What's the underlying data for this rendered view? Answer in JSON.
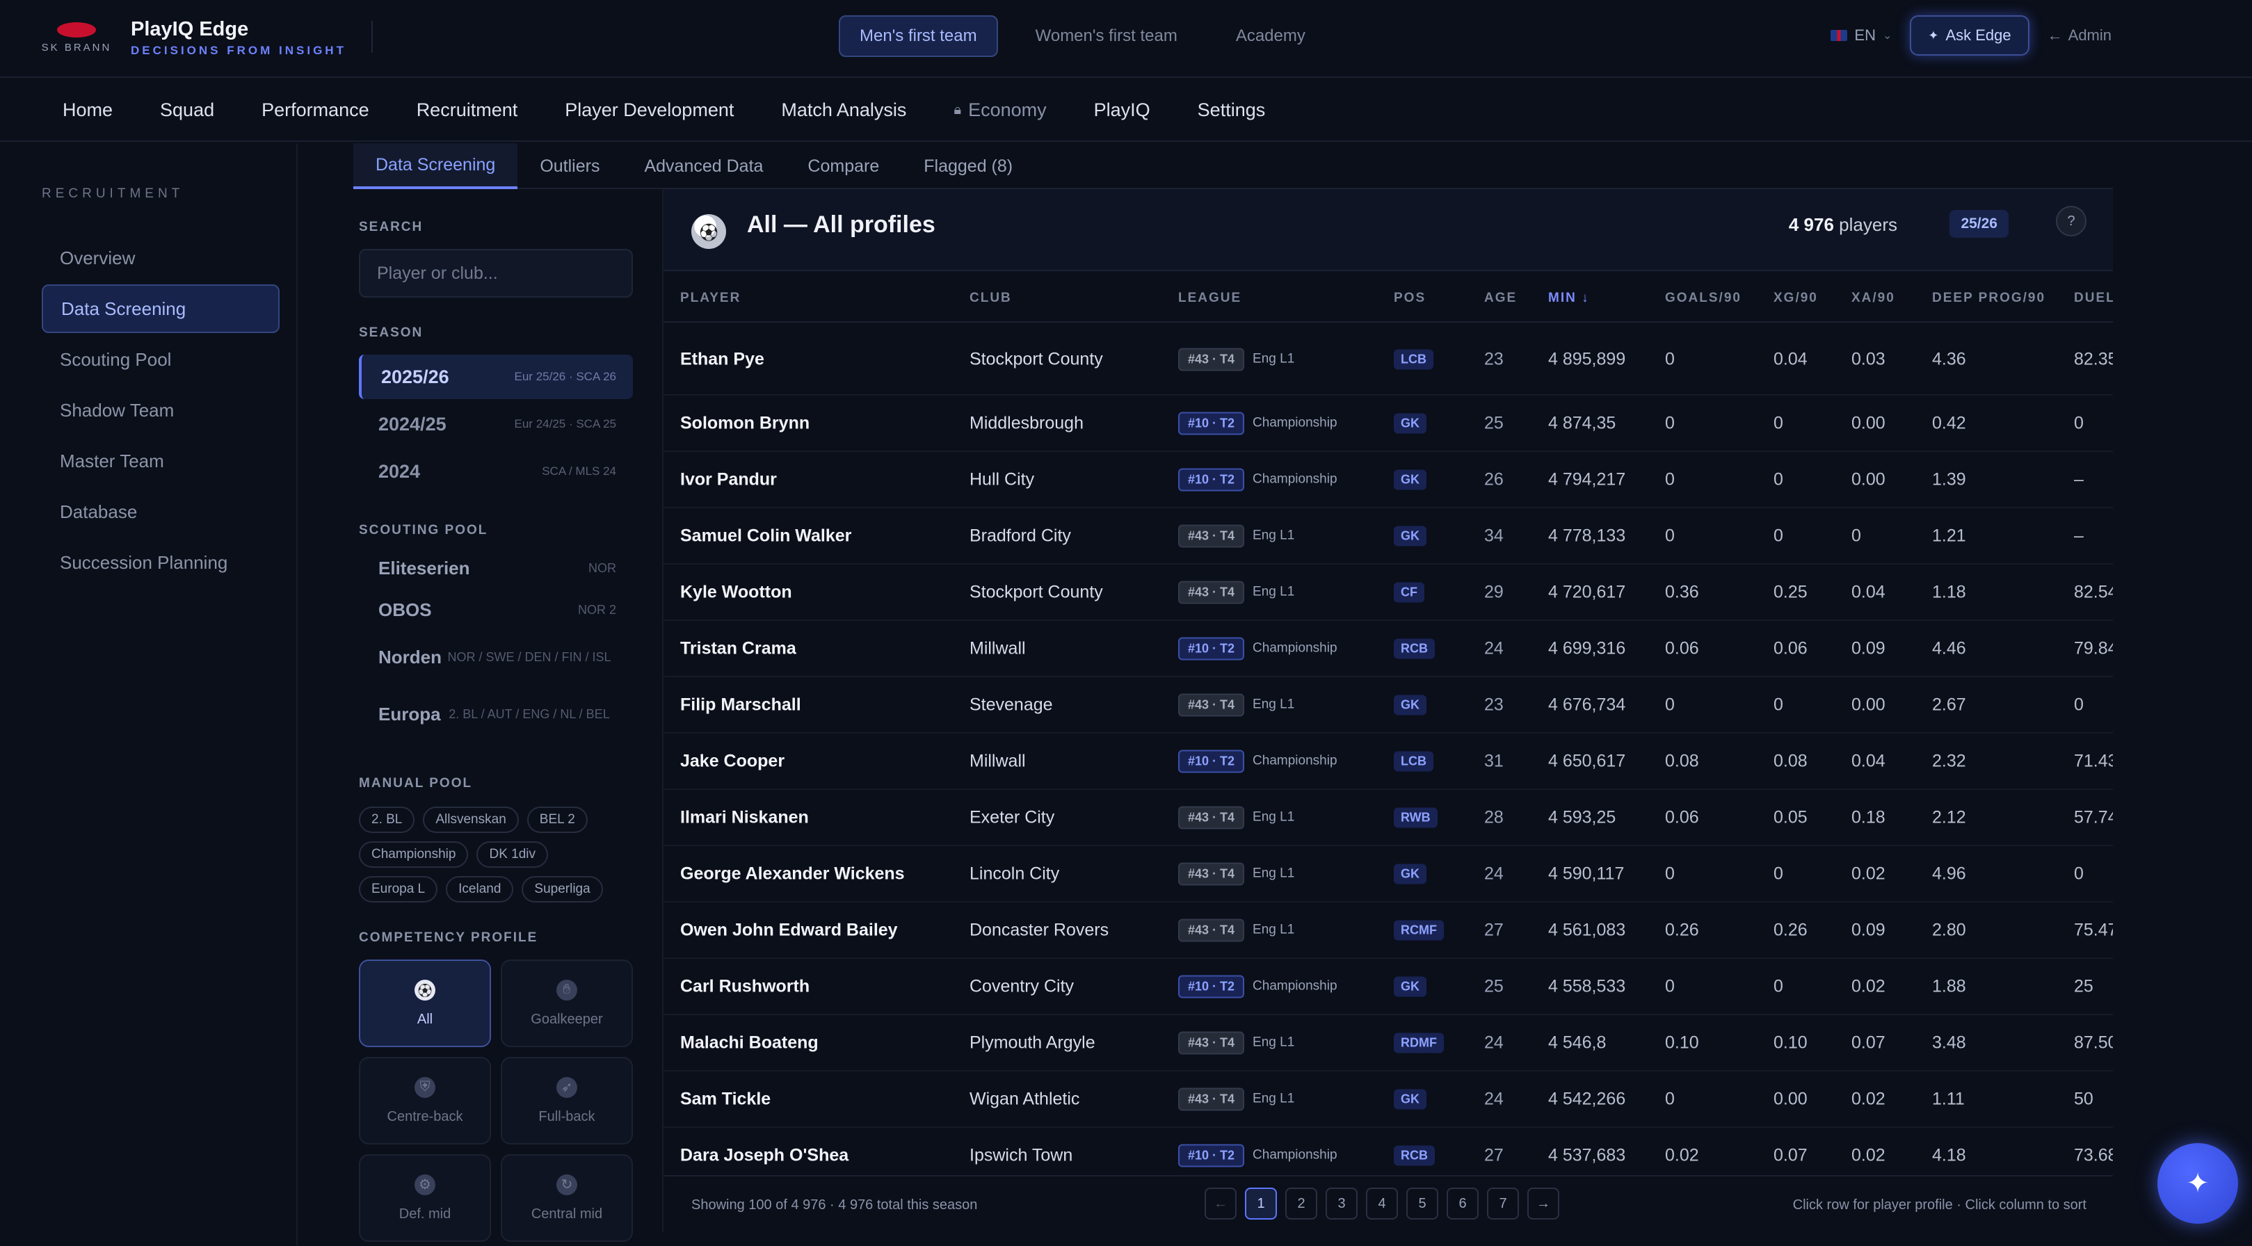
{
  "brand": {
    "club_name": "SK BRANN",
    "app_title": "PlayIQ Edge",
    "tagline": "DECISIONS FROM INSIGHT"
  },
  "teams": [
    "Men's first team",
    "Women's first team",
    "Academy"
  ],
  "top_right": {
    "lang": "EN",
    "ask_edge": "Ask Edge",
    "admin": "Admin"
  },
  "nav": [
    "Home",
    "Squad",
    "Performance",
    "Recruitment",
    "Player Development",
    "Match Analysis",
    "Economy",
    "PlayIQ",
    "Settings"
  ],
  "sidebar": {
    "heading": "RECRUITMENT",
    "items": [
      "Overview",
      "Data Screening",
      "Scouting Pool",
      "Shadow Team",
      "Master Team",
      "Database",
      "Succession Planning"
    ]
  },
  "subtabs": [
    "Data Screening",
    "Outliers",
    "Advanced Data",
    "Compare",
    "Flagged (8)"
  ],
  "filters": {
    "search_label": "SEARCH",
    "search_placeholder": "Player or club...",
    "season_label": "SEASON",
    "seasons": [
      {
        "name": "2025/26",
        "meta": "Eur 25/26 · SCA 26"
      },
      {
        "name": "2024/25",
        "meta": "Eur 24/25 · SCA 25"
      },
      {
        "name": "2024",
        "meta": "SCA / MLS 24"
      }
    ],
    "pool_label": "SCOUTING POOL",
    "pools": [
      {
        "name": "Eliteserien",
        "meta": "NOR"
      },
      {
        "name": "OBOS",
        "meta": "NOR 2"
      },
      {
        "name": "Norden",
        "meta": "NOR / SWE / DEN / FIN / ISL"
      },
      {
        "name": "Europa",
        "meta": "2. BL / AUT / ENG / NL / BEL"
      }
    ],
    "manual_label": "MANUAL POOL",
    "manual_tags": [
      "2. BL",
      "Allsvenskan",
      "BEL 2",
      "Championship",
      "DK 1div",
      "Europa L",
      "Iceland",
      "Superliga"
    ],
    "competency_label": "COMPETENCY PROFILE",
    "competencies": [
      "All",
      "Goalkeeper",
      "Centre-back",
      "Full-back",
      "Def. mid",
      "Central mid"
    ]
  },
  "table": {
    "title": "All — All profiles",
    "count": "4 976",
    "count_suffix": "players",
    "season_chip": "25/26",
    "help": "?",
    "columns": [
      "PLAYER",
      "CLUB",
      "LEAGUE",
      "POS",
      "AGE",
      "MIN ↓",
      "GOALS/90",
      "XG/90",
      "XA/90",
      "DEEP PROG/90",
      "DUEL"
    ],
    "rows": [
      {
        "player": "Ethan Pye",
        "club": "Stockport County",
        "badge": "#43 · T4",
        "league": "Eng L1",
        "pos": "LCB",
        "age": "23",
        "min": "4 895,899",
        "goals": "0",
        "xg": "0.04",
        "xa": "0.03",
        "deep": "4.36",
        "duel": "82.35"
      },
      {
        "player": "Solomon Brynn",
        "club": "Middlesbrough",
        "badge": "#10 · T2",
        "league": "Championship",
        "pos": "GK",
        "age": "25",
        "min": "4 874,35",
        "goals": "0",
        "xg": "0",
        "xa": "0.00",
        "deep": "0.42",
        "duel": "0"
      },
      {
        "player": "Ivor Pandur",
        "club": "Hull City",
        "badge": "#10 · T2",
        "league": "Championship",
        "pos": "GK",
        "age": "26",
        "min": "4 794,217",
        "goals": "0",
        "xg": "0",
        "xa": "0.00",
        "deep": "1.39",
        "duel": "–"
      },
      {
        "player": "Samuel Colin Walker",
        "club": "Bradford City",
        "badge": "#43 · T4",
        "league": "Eng L1",
        "pos": "GK",
        "age": "34",
        "min": "4 778,133",
        "goals": "0",
        "xg": "0",
        "xa": "0",
        "deep": "1.21",
        "duel": "–"
      },
      {
        "player": "Kyle Wootton",
        "club": "Stockport County",
        "badge": "#43 · T4",
        "league": "Eng L1",
        "pos": "CF",
        "age": "29",
        "min": "4 720,617",
        "goals": "0.36",
        "xg": "0.25",
        "xa": "0.04",
        "deep": "1.18",
        "duel": "82.54"
      },
      {
        "player": "Tristan Crama",
        "club": "Millwall",
        "badge": "#10 · T2",
        "league": "Championship",
        "pos": "RCB",
        "age": "24",
        "min": "4 699,316",
        "goals": "0.06",
        "xg": "0.06",
        "xa": "0.09",
        "deep": "4.46",
        "duel": "79.84"
      },
      {
        "player": "Filip Marschall",
        "club": "Stevenage",
        "badge": "#43 · T4",
        "league": "Eng L1",
        "pos": "GK",
        "age": "23",
        "min": "4 676,734",
        "goals": "0",
        "xg": "0",
        "xa": "0.00",
        "deep": "2.67",
        "duel": "0"
      },
      {
        "player": "Jake Cooper",
        "club": "Millwall",
        "badge": "#10 · T2",
        "league": "Championship",
        "pos": "LCB",
        "age": "31",
        "min": "4 650,617",
        "goals": "0.08",
        "xg": "0.08",
        "xa": "0.04",
        "deep": "2.32",
        "duel": "71.43"
      },
      {
        "player": "Ilmari Niskanen",
        "club": "Exeter City",
        "badge": "#43 · T4",
        "league": "Eng L1",
        "pos": "RWB",
        "age": "28",
        "min": "4 593,25",
        "goals": "0.06",
        "xg": "0.05",
        "xa": "0.18",
        "deep": "2.12",
        "duel": "57.74"
      },
      {
        "player": "George Alexander Wickens",
        "club": "Lincoln City",
        "badge": "#43 · T4",
        "league": "Eng L1",
        "pos": "GK",
        "age": "24",
        "min": "4 590,117",
        "goals": "0",
        "xg": "0",
        "xa": "0.02",
        "deep": "4.96",
        "duel": "0"
      },
      {
        "player": "Owen John Edward Bailey",
        "club": "Doncaster Rovers",
        "badge": "#43 · T4",
        "league": "Eng L1",
        "pos": "RCMF",
        "age": "27",
        "min": "4 561,083",
        "goals": "0.26",
        "xg": "0.26",
        "xa": "0.09",
        "deep": "2.80",
        "duel": "75.47"
      },
      {
        "player": "Carl Rushworth",
        "club": "Coventry City",
        "badge": "#10 · T2",
        "league": "Championship",
        "pos": "GK",
        "age": "25",
        "min": "4 558,533",
        "goals": "0",
        "xg": "0",
        "xa": "0.02",
        "deep": "1.88",
        "duel": "25"
      },
      {
        "player": "Malachi Boateng",
        "club": "Plymouth Argyle",
        "badge": "#43 · T4",
        "league": "Eng L1",
        "pos": "RDMF",
        "age": "24",
        "min": "4 546,8",
        "goals": "0.10",
        "xg": "0.10",
        "xa": "0.07",
        "deep": "3.48",
        "duel": "87.50"
      },
      {
        "player": "Sam Tickle",
        "club": "Wigan Athletic",
        "badge": "#43 · T4",
        "league": "Eng L1",
        "pos": "GK",
        "age": "24",
        "min": "4 542,266",
        "goals": "0",
        "xg": "0.00",
        "xa": "0.02",
        "deep": "1.11",
        "duel": "50"
      },
      {
        "player": "Dara Joseph O'Shea",
        "club": "Ipswich Town",
        "badge": "#10 · T2",
        "league": "Championship",
        "pos": "RCB",
        "age": "27",
        "min": "4 537,683",
        "goals": "0.02",
        "xg": "0.07",
        "xa": "0.02",
        "deep": "4.18",
        "duel": "73.68"
      }
    ],
    "footer": {
      "showing": "Showing 100 of 4 976 · 4 976 total this season",
      "pages": [
        "1",
        "2",
        "3",
        "4",
        "5",
        "6",
        "7"
      ],
      "hint": "Click row for player profile · Click column to sort"
    }
  }
}
